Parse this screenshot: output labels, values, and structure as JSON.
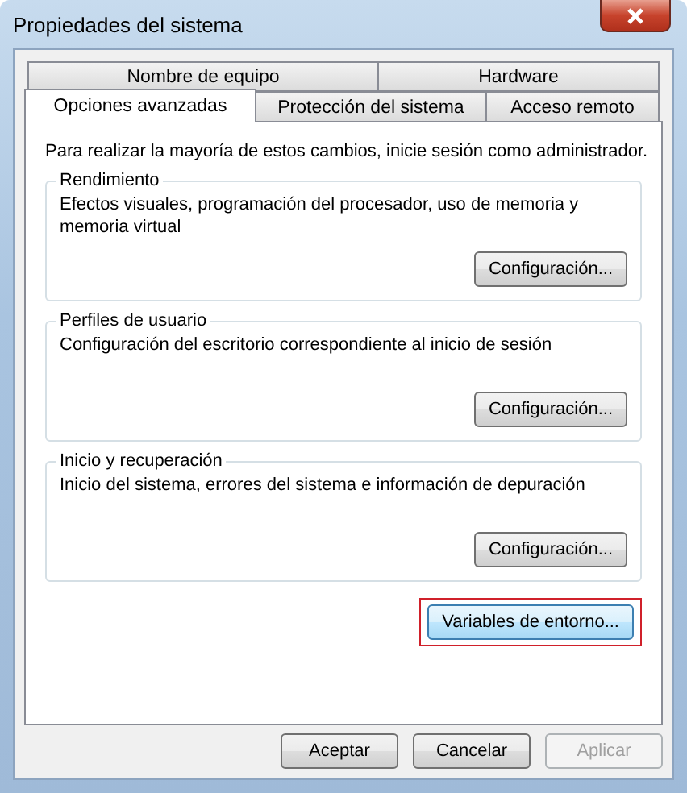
{
  "window": {
    "title": "Propiedades del sistema"
  },
  "tab_rows": [
    [
      {
        "label": "Nombre de equipo",
        "selected": false
      },
      {
        "label": "Hardware",
        "selected": false
      }
    ],
    [
      {
        "label": "Opciones avanzadas",
        "selected": true
      },
      {
        "label": "Protección del sistema",
        "selected": false
      },
      {
        "label": "Acceso remoto",
        "selected": false
      }
    ]
  ],
  "notice": "Para realizar la mayoría de estos cambios, inicie sesión como administrador.",
  "groups": [
    {
      "title": "Rendimiento",
      "description": "Efectos visuales, programación del procesador, uso de memoria y memoria virtual",
      "button": "Configuración..."
    },
    {
      "title": "Perfiles de usuario",
      "description": "Configuración del escritorio correspondiente al inicio de sesión",
      "button": "Configuración..."
    },
    {
      "title": "Inicio y recuperación",
      "description": "Inicio del sistema, errores del sistema e información de depuración",
      "button": "Configuración..."
    }
  ],
  "environment_button": {
    "label": "Variables de entorno...",
    "highlighted": true
  },
  "buttons": [
    {
      "label": "Aceptar",
      "disabled": false
    },
    {
      "label": "Cancelar",
      "disabled": false
    },
    {
      "label": "Aplicar",
      "disabled": true
    }
  ]
}
